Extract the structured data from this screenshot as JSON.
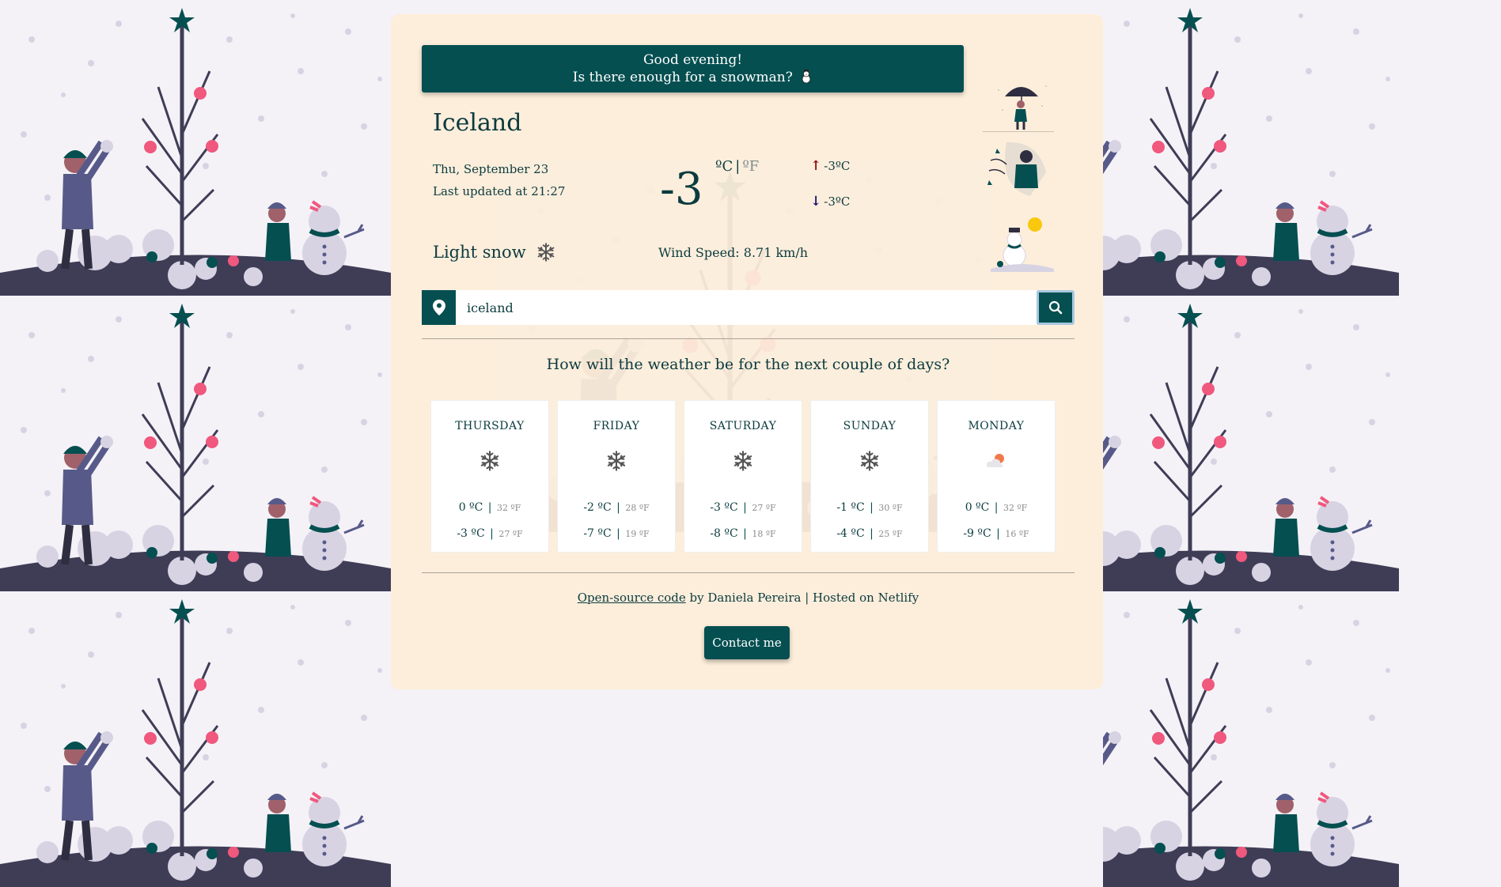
{
  "banner": {
    "line1": "Good evening!",
    "line2": "Is there enough for a snowman?"
  },
  "current": {
    "city": "Iceland",
    "date": "Thu, September 23",
    "updated_prefix": "Last updated at ",
    "updated_time": "21:27",
    "description": "Light snow",
    "description_icon": "snowflake-icon",
    "temperature": "-3",
    "unit_c": "ºC",
    "unit_sep": "|",
    "unit_f": "ºF",
    "temp_max": "-3ºC",
    "temp_min": "-3ºC",
    "wind": "Wind Speed: 8.71 km/h"
  },
  "search": {
    "value": "iceland",
    "pin_icon": "location-pin-icon",
    "search_icon": "search-icon"
  },
  "forecast": {
    "title": "How will the weather be for the next couple of days?",
    "days": [
      {
        "name": "THURSDAY",
        "icon": "snowflake-icon",
        "max_c": "0 ºC",
        "max_f": "32 ºF",
        "min_c": "-3 ºC",
        "min_f": "27 ºF"
      },
      {
        "name": "FRIDAY",
        "icon": "snowflake-icon",
        "max_c": "-2 ºC",
        "max_f": "28 ºF",
        "min_c": "-7 ºC",
        "min_f": "19 ºF"
      },
      {
        "name": "SATURDAY",
        "icon": "snowflake-icon",
        "max_c": "-3 ºC",
        "max_f": "27 ºF",
        "min_c": "-8 ºC",
        "min_f": "18 ºF"
      },
      {
        "name": "SUNDAY",
        "icon": "snowflake-icon",
        "max_c": "-1 ºC",
        "max_f": "30 ºF",
        "min_c": "-4 ºC",
        "min_f": "25 ºF"
      },
      {
        "name": "MONDAY",
        "icon": "cloud-sun-icon",
        "max_c": "0 ºC",
        "max_f": "32 ºF",
        "min_c": "-9 ºC",
        "min_f": "16 ºF"
      }
    ]
  },
  "footer": {
    "link": "Open-source code",
    "text": " by Daniela Pereira | Hosted on Netlify",
    "contact": "Contact me"
  },
  "colors": {
    "primary": "#054f51",
    "card": "#fdeedb",
    "text": "#0b3b3f",
    "max_arrow": "#8b0e0e",
    "min_arrow": "#151570"
  }
}
